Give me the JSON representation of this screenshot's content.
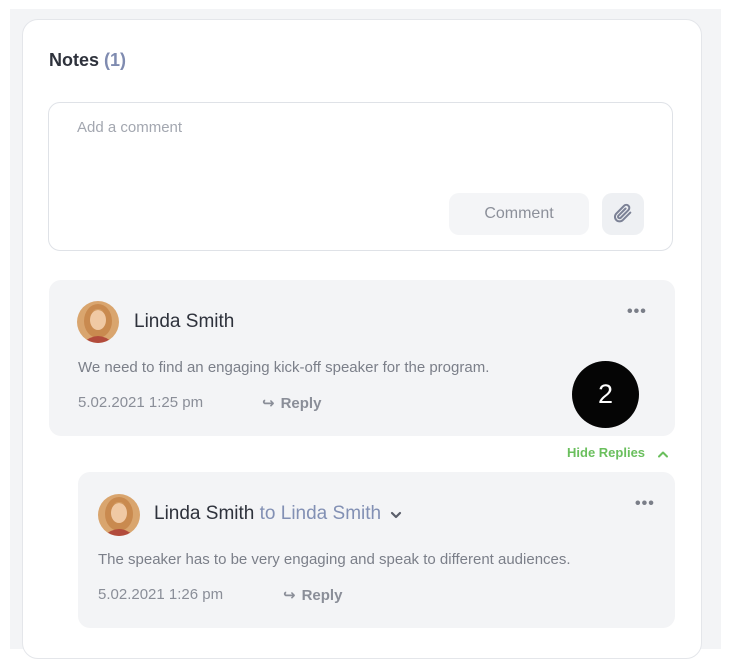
{
  "notes": {
    "title": "Notes",
    "count": "(1)"
  },
  "composer": {
    "placeholder": "Add a comment",
    "comment_label": "Comment",
    "attach_icon": "paperclip-icon"
  },
  "comments": [
    {
      "author": "Linda Smith",
      "text": "We need to find an engaging kick-off speaker for the program.",
      "timestamp": "5.02.2021 1:25 pm",
      "reply_label": "Reply",
      "more_label": "•••"
    }
  ],
  "badge": "2",
  "hide_replies_label": "Hide Replies",
  "replies": [
    {
      "author": "Linda Smith",
      "to_text": "to Linda Smith",
      "text": "The speaker has to be very engaging and speak to different audiences.",
      "timestamp": "5.02.2021 1:26 pm",
      "reply_label": "Reply",
      "more_label": "•••"
    }
  ],
  "colors": {
    "accent_green": "#6abf5d",
    "mention_blue": "#8290b4",
    "count_blue": "#7f8bb0"
  }
}
